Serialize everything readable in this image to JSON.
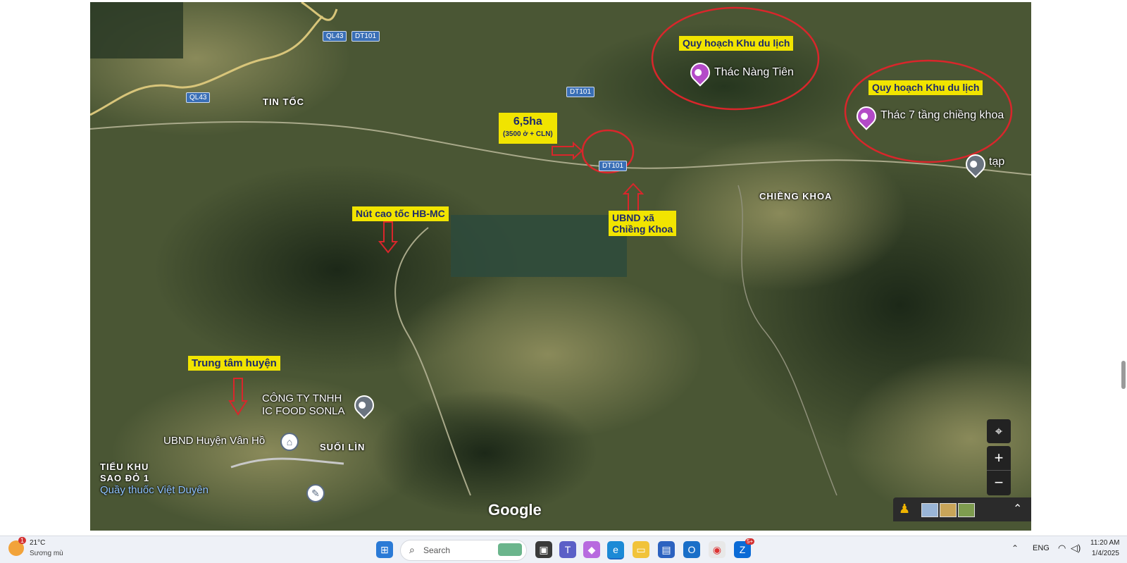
{
  "map": {
    "town_labels": {
      "tin_toc": "TIN TỐC",
      "chieng_khoa": "CHIỀNG KHOA",
      "suoi_lin": "SUỐI LÌN",
      "tieu_khu_1": "TIỂU KHU",
      "tieu_khu_2": "SAO ĐỎ 1"
    },
    "road_tags": [
      "QL43",
      "DT101",
      "QL43",
      "DT101",
      "DT101"
    ],
    "pois": {
      "thac_nang_tien": "Thác Nàng Tiên",
      "thac_7_tang": "Thác 7 tầng chiềng khoa",
      "tap": "tạp",
      "cong_ty_1": "CÔNG TY TNHH",
      "cong_ty_2": "IC FOOD SONLA",
      "ubnd_huyen": "UBND Huyện Vân Hồ",
      "quay_thuoc": "Quầy thuốc Việt Duyên"
    },
    "annotations": {
      "quy_hoach_1": "Quy hoạch Khu du lịch",
      "quy_hoach_2": "Quy hoạch Khu du lịch",
      "area_main": "6,5ha",
      "area_sub": "(3500 ở + CLN)",
      "ubnd_xa_1": "UBND xã",
      "ubnd_xa_2": "Chiềng Khoa",
      "nut_cao_toc": "Nút cao tốc HB-MC",
      "trung_tam": "Trung tâm huyện"
    },
    "logo": "Google",
    "controls": {
      "zoom_in": "+",
      "zoom_out": "−",
      "locate_icon": "crosshair-icon",
      "pegman_icon": "pegman-icon",
      "expand_icon": "double-chevron-up-icon"
    },
    "colors": {
      "annotation_bg": "#f1e400",
      "annotation_text": "#1d2a6b",
      "circle_red": "#d9262b",
      "poi_purple": "#b34ac7"
    }
  },
  "taskbar": {
    "weather": {
      "temp": "21°C",
      "condition": "Sương mù",
      "badge": "1"
    },
    "search_placeholder": "Search",
    "language": "ENG",
    "time": "11:20 AM",
    "date": "1/4/2025",
    "notification_badge": "5+"
  }
}
